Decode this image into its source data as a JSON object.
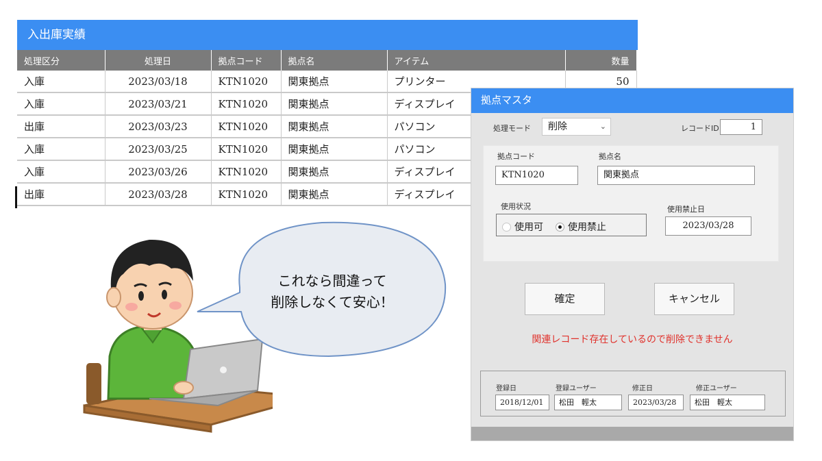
{
  "ledger": {
    "title": "入出庫実績",
    "columns": [
      "処理区分",
      "処理日",
      "拠点コード",
      "拠点名",
      "アイテム",
      "数量"
    ],
    "rows": [
      [
        "入庫",
        "2023/03/18",
        "KTN1020",
        "関東拠点",
        "プリンター",
        "50"
      ],
      [
        "入庫",
        "2023/03/21",
        "KTN1020",
        "関東拠点",
        "ディスプレイ",
        ""
      ],
      [
        "出庫",
        "2023/03/23",
        "KTN1020",
        "関東拠点",
        "パソコン",
        ""
      ],
      [
        "入庫",
        "2023/03/25",
        "KTN1020",
        "関東拠点",
        "パソコン",
        ""
      ],
      [
        "入庫",
        "2023/03/26",
        "KTN1020",
        "関東拠点",
        "ディスプレイ",
        ""
      ],
      [
        "出庫",
        "2023/03/28",
        "KTN1020",
        "関東拠点",
        "ディスプレイ",
        ""
      ]
    ]
  },
  "master": {
    "title": "拠点マスタ",
    "mode_label": "処理モード",
    "mode_value": "削除",
    "record_id_label": "レコードID",
    "record_id_value": "1",
    "code_label": "拠点コード",
    "code_value": "KTN1020",
    "name_label": "拠点名",
    "name_value": "関東拠点",
    "usage_label": "使用状況",
    "usage_options": [
      "使用可",
      "使用禁止"
    ],
    "usage_selected": "使用禁止",
    "ban_date_label": "使用禁止日",
    "ban_date_value": "2023/03/28",
    "confirm_label": "確定",
    "cancel_label": "キャンセル",
    "error_message": "関連レコード存在しているので削除できません",
    "audit": {
      "created_date_label": "登録日",
      "created_date_value": "2018/12/01",
      "created_user_label": "登録ユーザー",
      "created_user_value": "松田　輕太",
      "updated_date_label": "修正日",
      "updated_date_value": "2023/03/28",
      "updated_user_label": "修正ユーザー",
      "updated_user_value": "松田　輕太"
    }
  },
  "bubble": {
    "line1": "これなら間違って",
    "line2": "削除しなくて安心！"
  },
  "colors": {
    "accent": "#3b8ef2",
    "header_gray": "#7b7b7b",
    "error": "#e0312b",
    "shirt": "#5cb53a"
  }
}
